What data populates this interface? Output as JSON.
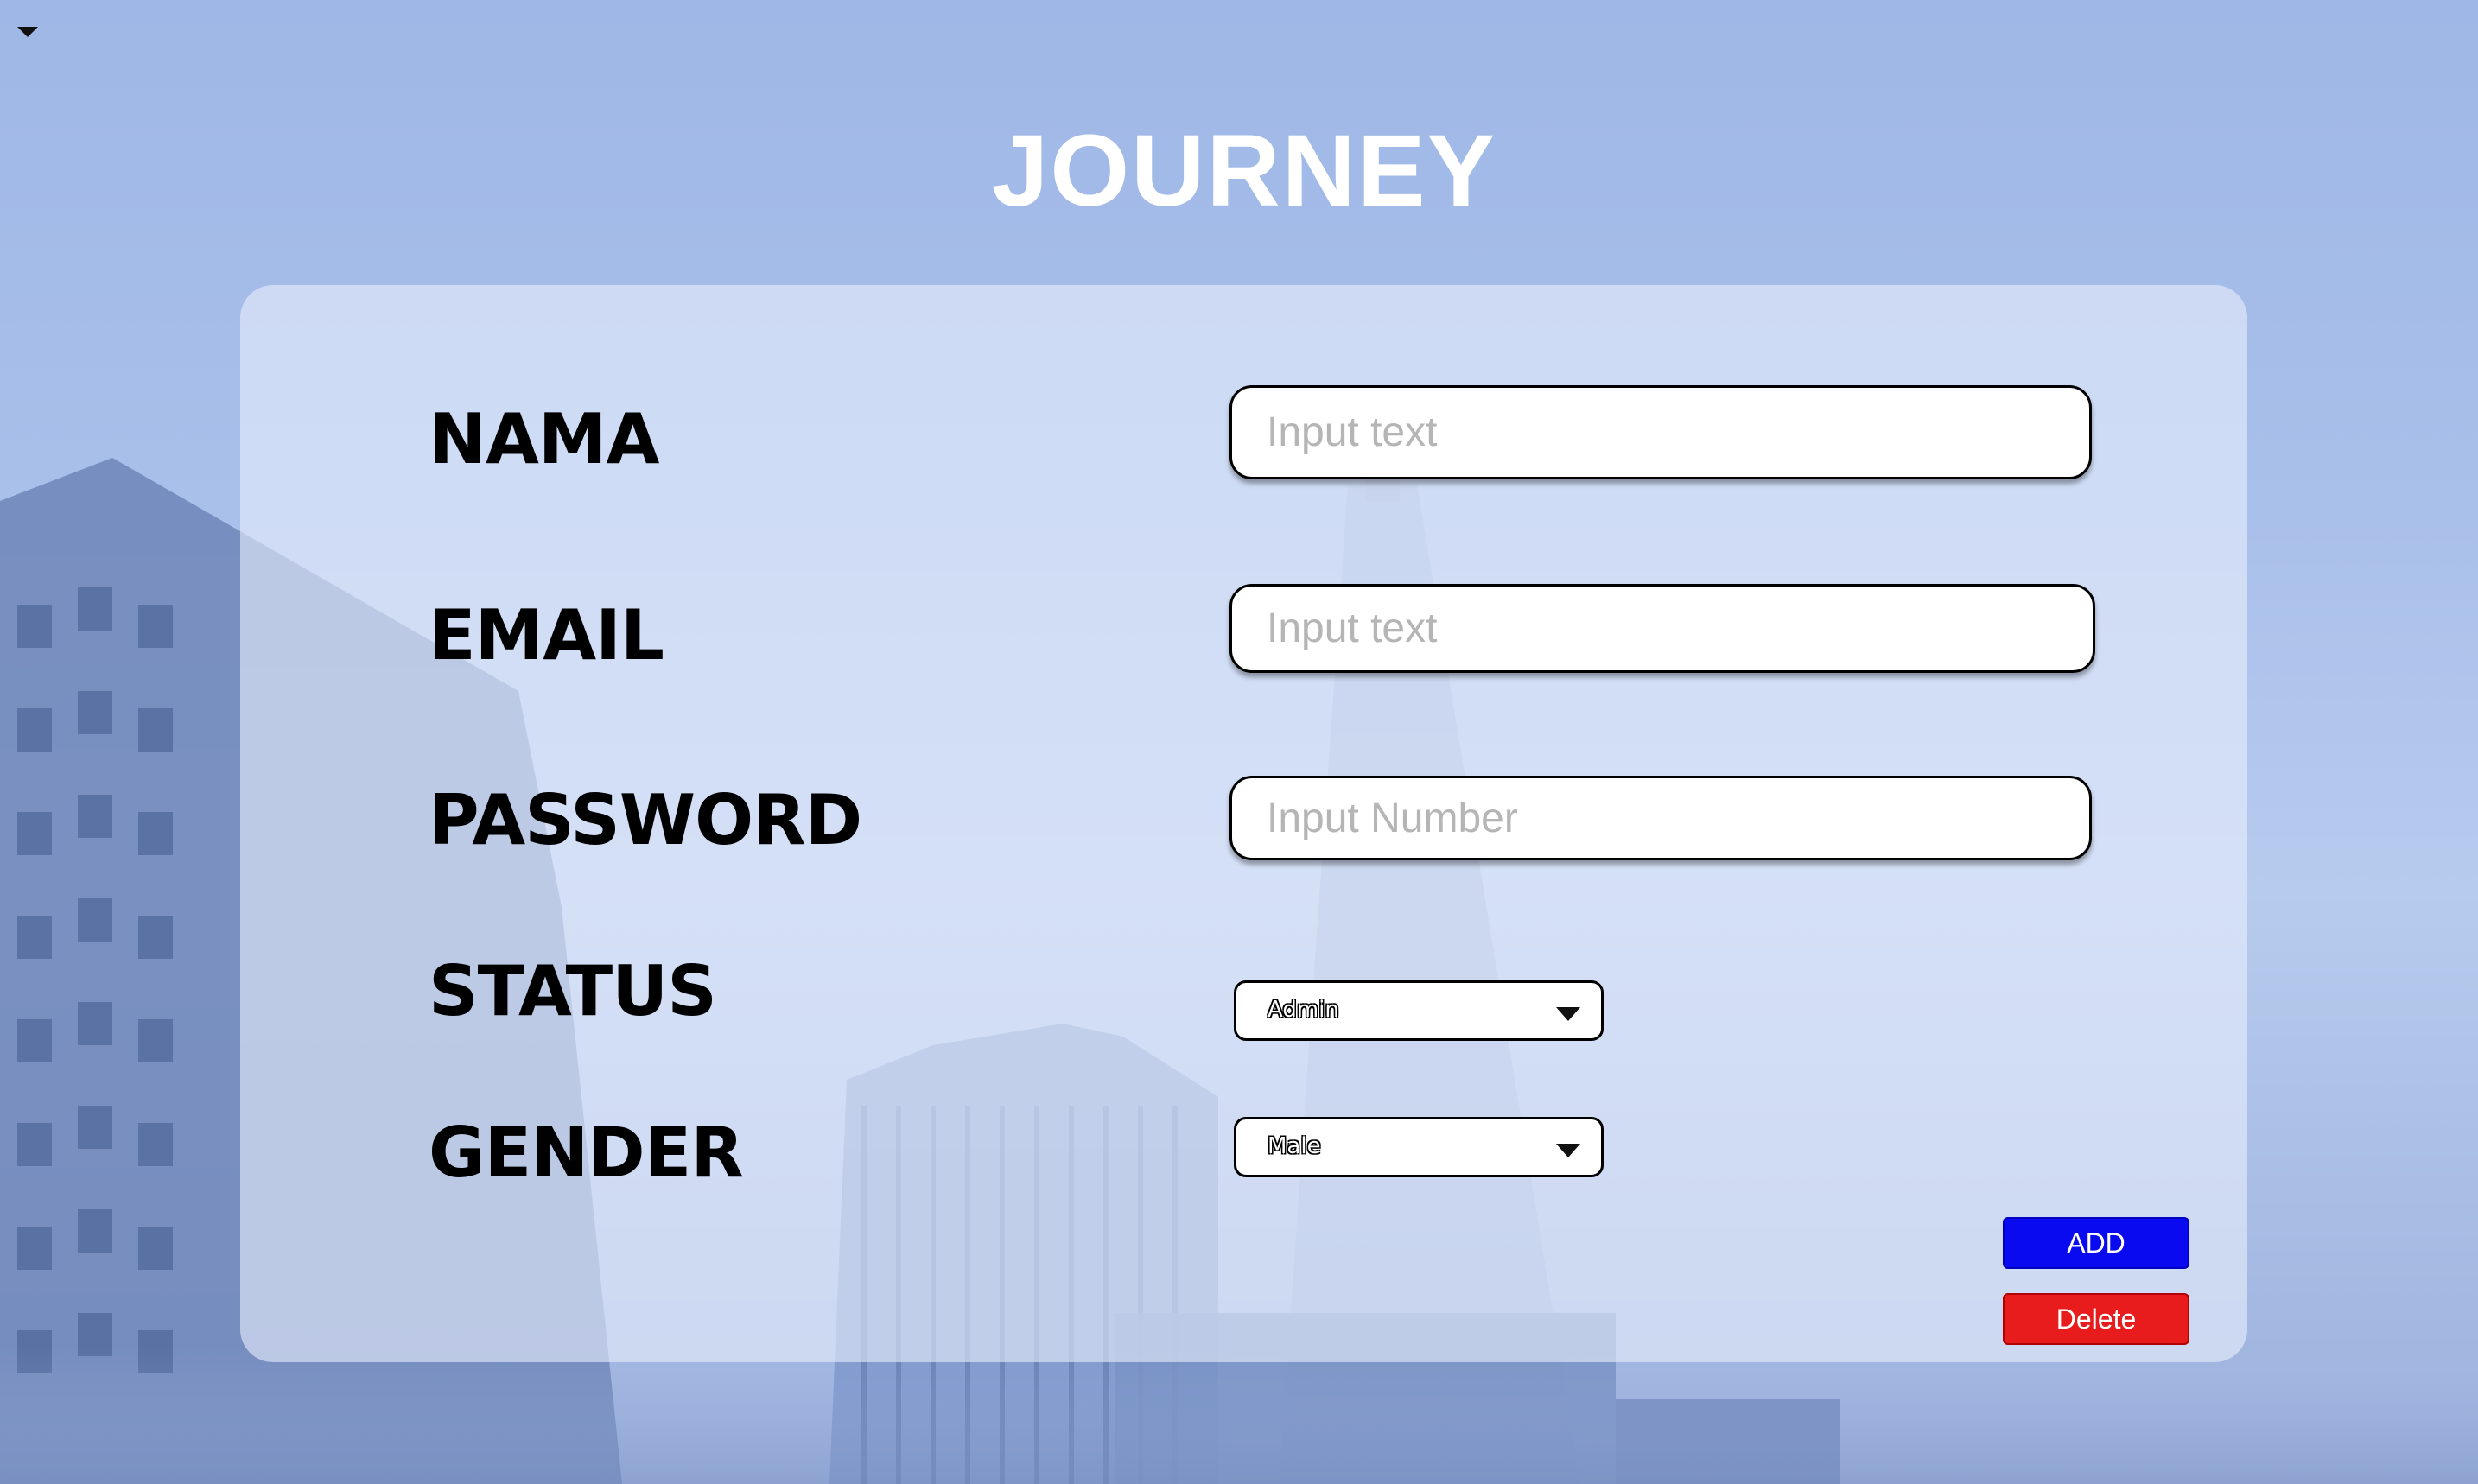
{
  "header": {
    "title": "JOURNEY"
  },
  "form": {
    "fields": [
      {
        "label": "NAMA",
        "placeholder": "Input text",
        "value": ""
      },
      {
        "label": "EMAIL",
        "placeholder": "Input text",
        "value": ""
      },
      {
        "label": "PASSWORD",
        "placeholder": "Input Number",
        "value": ""
      }
    ],
    "status": {
      "label": "STATUS",
      "selected": "Admin"
    },
    "gender": {
      "label": "GENDER",
      "selected": "Male"
    }
  },
  "actions": {
    "add_label": "ADD",
    "delete_label": "Delete"
  },
  "colors": {
    "add_button": "#0a0af0",
    "delete_button": "#e81c1c",
    "title": "#ffffff",
    "background": "#a9c0ea"
  },
  "icons": {
    "menu_toggle": "caret-down-icon",
    "select_arrow": "caret-down-icon"
  }
}
